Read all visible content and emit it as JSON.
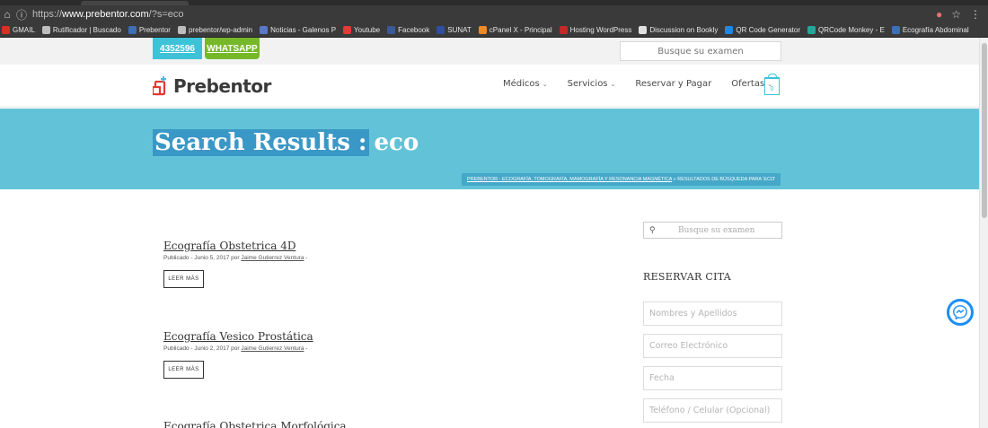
{
  "browser": {
    "url_prefix": "https://",
    "url_host": "www.prebentor.com",
    "url_path": "/?s=eco",
    "bookmarks": [
      {
        "label": "GMAIL",
        "color": "#d93025"
      },
      {
        "label": "Rutificador | Buscado",
        "color": "#bdbdbd"
      },
      {
        "label": "Prebentor",
        "color": "#3d6fb5"
      },
      {
        "label": "prebentor/wp-admin",
        "color": "#bdbdbd"
      },
      {
        "label": "Noticias - Galenos P",
        "color": "#5a78c8"
      },
      {
        "label": "Youtube",
        "color": "#e53935"
      },
      {
        "label": "Facebook",
        "color": "#3b5998"
      },
      {
        "label": "SUNAT",
        "color": "#2f4f9e"
      },
      {
        "label": "cPanel X - Principal",
        "color": "#f08a24"
      },
      {
        "label": "Hosting WordPress",
        "color": "#c62828"
      },
      {
        "label": "Discussion on Bookly",
        "color": "#e0e0e0"
      },
      {
        "label": "QR Code Generator",
        "color": "#1e88e5"
      },
      {
        "label": "QRCode Monkey - E",
        "color": "#26a69a"
      },
      {
        "label": "Ecografía Abdominal",
        "color": "#3d6fb5"
      }
    ]
  },
  "topbar": {
    "phone": "4352596",
    "whatsapp": "WHATSAPP",
    "search_placeholder": "Busque su examen"
  },
  "header": {
    "logo_text": "Prebentor",
    "nav": [
      {
        "label": "Médicos",
        "dropdown": true
      },
      {
        "label": "Servicios",
        "dropdown": true
      },
      {
        "label": "Reservar y Pagar",
        "dropdown": false
      },
      {
        "label": "Ofertas",
        "dropdown": true
      }
    ],
    "cart_count": "0"
  },
  "hero": {
    "title_selected": "Search Results :",
    "title_term": "eco",
    "breadcrumb_link": "PREBENTOR - ECOGRAFÍA, TOMOGRAFÍA, MAMOGRAFÍA Y RESONANCIA MAGNÉTICA",
    "breadcrumb_sep": "»",
    "breadcrumb_current": "RESULTADOS DE BÚSQUEDA PARA 'ECO'"
  },
  "results": [
    {
      "title": "Ecografía Obstetrica 4D",
      "meta_prefix": "Publicado - Junio 5, 2017 por",
      "author": "Jaime Gutierrez Ventura",
      "meta_suffix": "-",
      "read_more": "LEER MÁS"
    },
    {
      "title": "Ecografía Vesico Prostática",
      "meta_prefix": "Publicado - Junio 2, 2017 por",
      "author": "Jaime Gutierrez Ventura",
      "meta_suffix": "-",
      "read_more": "LEER MÁS"
    },
    {
      "title": "Ecografía Obstetrica Morfológica"
    }
  ],
  "sidebar": {
    "search_placeholder": "Busque su examen",
    "title": "RESERVAR CITA",
    "fields": [
      {
        "placeholder": "Nombres y Apellidos"
      },
      {
        "placeholder": "Correo Electrónico"
      },
      {
        "placeholder": "Fecha"
      },
      {
        "placeholder": "Teléfono / Celular (Opcional)"
      }
    ]
  },
  "colors": {
    "accent": "#3dc2d8",
    "hero_bg": "#62c3d8",
    "whatsapp": "#76b82a",
    "logo_red": "#e53935"
  }
}
